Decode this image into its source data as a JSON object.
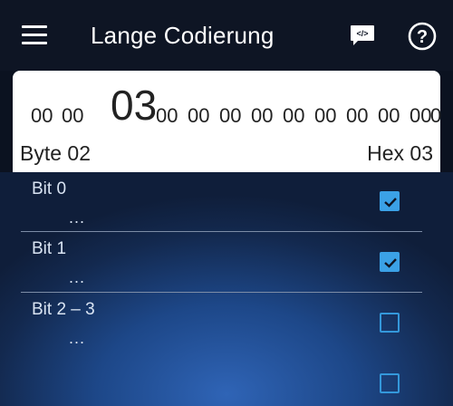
{
  "appbar": {
    "title": "Lange Codierung",
    "icons": {
      "menu": "menu-icon",
      "code": "code-view-icon",
      "help": "help-icon"
    }
  },
  "coding": {
    "bytes_before": [
      "00",
      "00"
    ],
    "selected_byte": "03",
    "bytes_after": [
      "00",
      "00",
      "00",
      "00",
      "00",
      "00",
      "00",
      "00",
      "00",
      "0"
    ],
    "byte_label": "Byte 02",
    "hex_label": "Hex 03"
  },
  "bits": [
    {
      "label": "Bit 0",
      "value": "...",
      "checked": true
    },
    {
      "label": "Bit 1",
      "value": "...",
      "checked": true
    },
    {
      "label": "Bit 2 – 3",
      "value": "...",
      "checked": false
    },
    {
      "label": "",
      "value": "",
      "checked": false
    }
  ],
  "colors": {
    "accent": "#3ba1e6",
    "appbar": "#0e1524",
    "card": "#ffffff"
  }
}
